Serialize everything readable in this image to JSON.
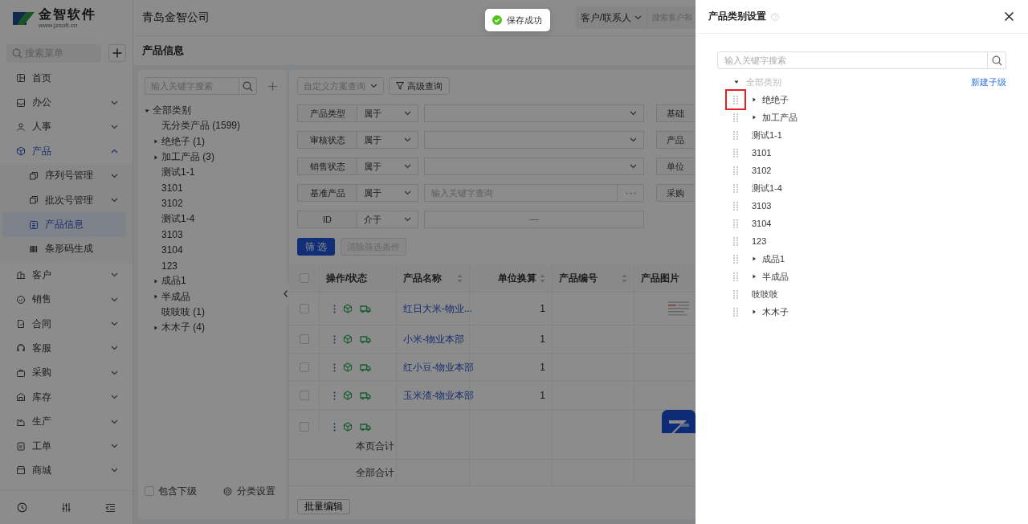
{
  "app": {
    "logo_name": "金智软件",
    "logo_url": "www.jzsoft.cn",
    "company": "青岛金智公司",
    "customer_scope": "客户/联系人",
    "customer_placeholder": "搜索客户和"
  },
  "sidebar": {
    "search_placeholder": "搜索菜单",
    "items": [
      {
        "label": "首页",
        "selected": false
      },
      {
        "label": "办公",
        "selected": false,
        "expanded": false
      },
      {
        "label": "人事",
        "selected": false,
        "expanded": false
      },
      {
        "label": "产品",
        "selected": true,
        "expanded": true,
        "children": [
          {
            "label": "序列号管理",
            "selected": false,
            "expanded": false
          },
          {
            "label": "批次号管理",
            "selected": false,
            "expanded": false
          },
          {
            "label": "产品信息",
            "selected": true
          },
          {
            "label": "条形码生成",
            "selected": false
          }
        ]
      },
      {
        "label": "客户",
        "selected": false,
        "expanded": false
      },
      {
        "label": "销售",
        "selected": false,
        "expanded": false
      },
      {
        "label": "合同",
        "selected": false,
        "expanded": false
      },
      {
        "label": "客服",
        "selected": false,
        "expanded": false
      },
      {
        "label": "采购",
        "selected": false,
        "expanded": false
      },
      {
        "label": "库存",
        "selected": false,
        "expanded": false
      },
      {
        "label": "生产",
        "selected": false,
        "expanded": false
      },
      {
        "label": "工单",
        "selected": false,
        "expanded": false
      },
      {
        "label": "商城",
        "selected": false,
        "expanded": false
      }
    ]
  },
  "page_title": "产品信息",
  "category_panel": {
    "search_placeholder": "输入关键字搜索",
    "tree": {
      "label": "全部类别",
      "expanded": true,
      "children": [
        {
          "label": "无分类产品",
          "count": "(1599)"
        },
        {
          "label": "绝绝子",
          "count": "(1)",
          "expanded": false
        },
        {
          "label": "加工产品",
          "count": "(3)",
          "expanded": false
        },
        {
          "label": "测试1-1"
        },
        {
          "label": "3101"
        },
        {
          "label": "3102"
        },
        {
          "label": "测试1-4"
        },
        {
          "label": "3103"
        },
        {
          "label": "3104"
        },
        {
          "label": "123"
        },
        {
          "label": "成品1",
          "expanded": false
        },
        {
          "label": "半成品",
          "expanded": false
        },
        {
          "label": "吱吱吱",
          "count": "(1)"
        },
        {
          "label": "木木子",
          "count": "(4)",
          "expanded": false
        }
      ]
    },
    "include_sub": {
      "label": "包含下级",
      "checked": false
    },
    "settings": "分类设置"
  },
  "filters": {
    "scheme": "自定义方案查询",
    "advanced": "高级查询",
    "rows": [
      {
        "kind": "select",
        "field": "产品类型",
        "operator": "属于",
        "field_2": "基础"
      },
      {
        "kind": "select",
        "field": "审核状态",
        "operator": "属于",
        "field_2": "产品"
      },
      {
        "kind": "select",
        "field": "销售状态",
        "operator": "属于",
        "field_2": "单位"
      },
      {
        "kind": "lookup",
        "field": "基准产品",
        "operator": "属于",
        "placeholder": "输入关键字查询",
        "field_2": "采购"
      },
      {
        "kind": "range",
        "field": "ID",
        "operator": "介于",
        "separator": "—"
      }
    ],
    "apply": "筛 选",
    "clear": {
      "label": "清除筛选条件",
      "disabled": true
    }
  },
  "table": {
    "all_selected": false,
    "columns": [
      {
        "label": "操作/状态",
        "sortable": false
      },
      {
        "label": "产品名称",
        "sortable": true
      },
      {
        "label": "单位换算",
        "sortable": true
      },
      {
        "label": "产品编号",
        "sortable": true
      },
      {
        "label": "产品图片",
        "sortable": false
      }
    ],
    "rows": [
      {
        "selected": false,
        "name": "红日大米-物业...",
        "unit": "1",
        "picture": true
      },
      {
        "selected": false,
        "name": "小米-物业本部",
        "unit": "1"
      },
      {
        "selected": false,
        "name": "红小豆-物业本部",
        "unit": "1"
      },
      {
        "selected": false,
        "name": "玉米渣-物业本部",
        "unit": "1"
      },
      {
        "selected": false,
        "picture": true
      }
    ],
    "summary": [
      "本页合计",
      "全部合计"
    ],
    "batch_edit": "批量编辑"
  },
  "toast": {
    "kind": "success",
    "text": "保存成功"
  },
  "drawer": {
    "title": "产品类别设置",
    "search_placeholder": "输入关键字搜索",
    "root": "全部类别",
    "new_child": "新建子级",
    "items": [
      {
        "label": "绝绝子",
        "expanded": false,
        "highlighted": true
      },
      {
        "label": "加工产品",
        "expanded": false,
        "highlighted": false
      },
      {
        "label": "测试1-1",
        "highlighted": false
      },
      {
        "label": "3101",
        "highlighted": false
      },
      {
        "label": "3102",
        "highlighted": false
      },
      {
        "label": "测试1-4",
        "highlighted": false
      },
      {
        "label": "3103",
        "highlighted": false
      },
      {
        "label": "3104",
        "highlighted": false
      },
      {
        "label": "123",
        "highlighted": false
      },
      {
        "label": "成品1",
        "expanded": false,
        "highlighted": false
      },
      {
        "label": "半成品",
        "expanded": false,
        "highlighted": false
      },
      {
        "label": "吱吱吱",
        "highlighted": false
      },
      {
        "label": "木木子",
        "expanded": false,
        "highlighted": false
      }
    ]
  }
}
